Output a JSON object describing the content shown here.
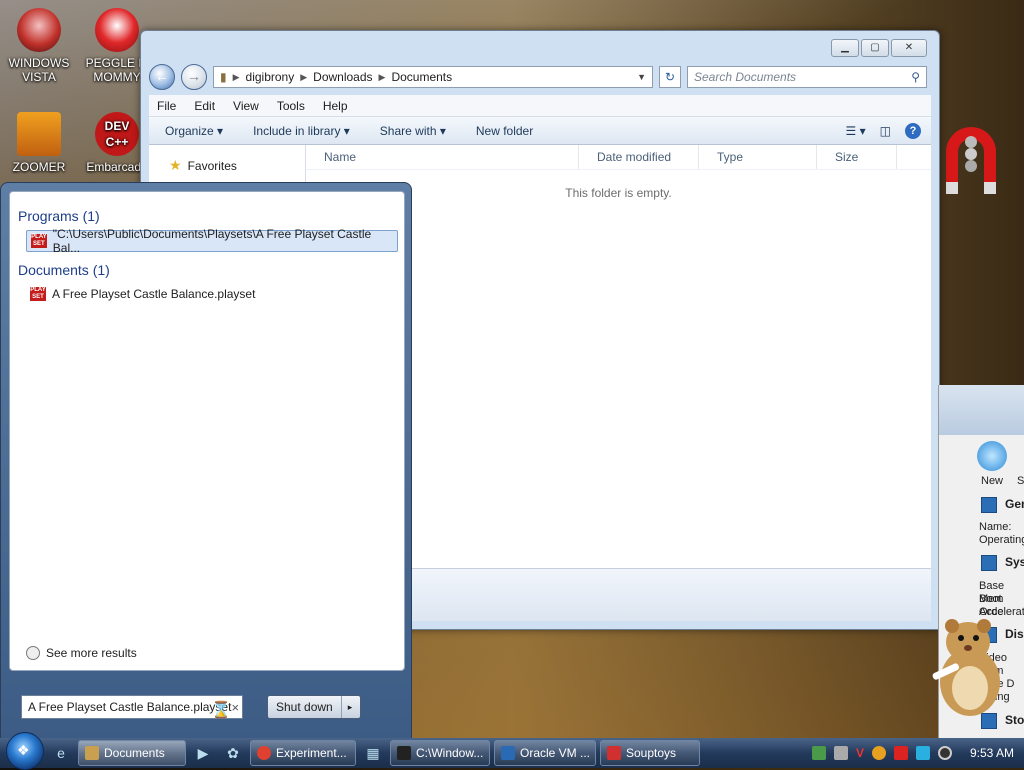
{
  "desktop": {
    "icons": [
      {
        "label": "WINDOWS VISTA"
      },
      {
        "label": "PEGGLE M MOMMY"
      },
      {
        "label": "ZOOMER"
      },
      {
        "label": "Embarcade"
      }
    ],
    "dev_label": "DEV C++"
  },
  "explorer": {
    "window_controls": {
      "minimize": "▁",
      "maximize": "▢",
      "close": "✕"
    },
    "breadcrumb": [
      "digibrony",
      "Downloads",
      "Documents"
    ],
    "search_placeholder": "Search Documents",
    "menu": [
      "File",
      "Edit",
      "View",
      "Tools",
      "Help"
    ],
    "commands": {
      "organize": "Organize ▾",
      "include_in_library": "Include in library ▾",
      "share_with": "Share with ▾",
      "new_folder": "New folder"
    },
    "nav": {
      "favorites": "Favorites"
    },
    "columns": [
      "Name",
      "Date modified",
      "Type",
      "Size"
    ],
    "empty_message": "This folder is empty."
  },
  "start_menu": {
    "programs_header": "Programs (1)",
    "program_item": "\"C:\\Users\\Public\\Documents\\Playsets\\A Free Playset Castle Bal...",
    "documents_header": "Documents (1)",
    "document_item": "A Free Playset Castle Balance.playset",
    "see_more": "See more results",
    "search_value": "A Free Playset Castle Balance.playset",
    "clear": "×",
    "shutdown": "Shut down",
    "shutdown_arrow": "▸",
    "play_icon_text": "PLAY SET"
  },
  "vbox": {
    "new_label": "New",
    "s_label": "S",
    "sections": [
      "Gen",
      "Sys",
      "Disp",
      "Sto"
    ],
    "general_text": [
      "Name:",
      "Operating"
    ],
    "system_text": [
      "Base Mem",
      "Boot Orde",
      "Accelerat"
    ],
    "display_text": [
      "Video Mem",
      "hics",
      "mote D",
      "ording"
    ]
  },
  "taskbar": {
    "buttons": [
      {
        "label": "Documents",
        "color": "#c8a050",
        "active": true
      },
      {
        "label": "Experiment...",
        "color": "#e04030",
        "active": false
      },
      {
        "label": "C:\\Window...",
        "color": "#222222",
        "active": false
      },
      {
        "label": "Oracle VM ...",
        "color": "#2a6ab5",
        "active": false
      },
      {
        "label": "Souptoys",
        "color": "#d03030",
        "active": false
      }
    ],
    "clock": "9:53 AM"
  }
}
